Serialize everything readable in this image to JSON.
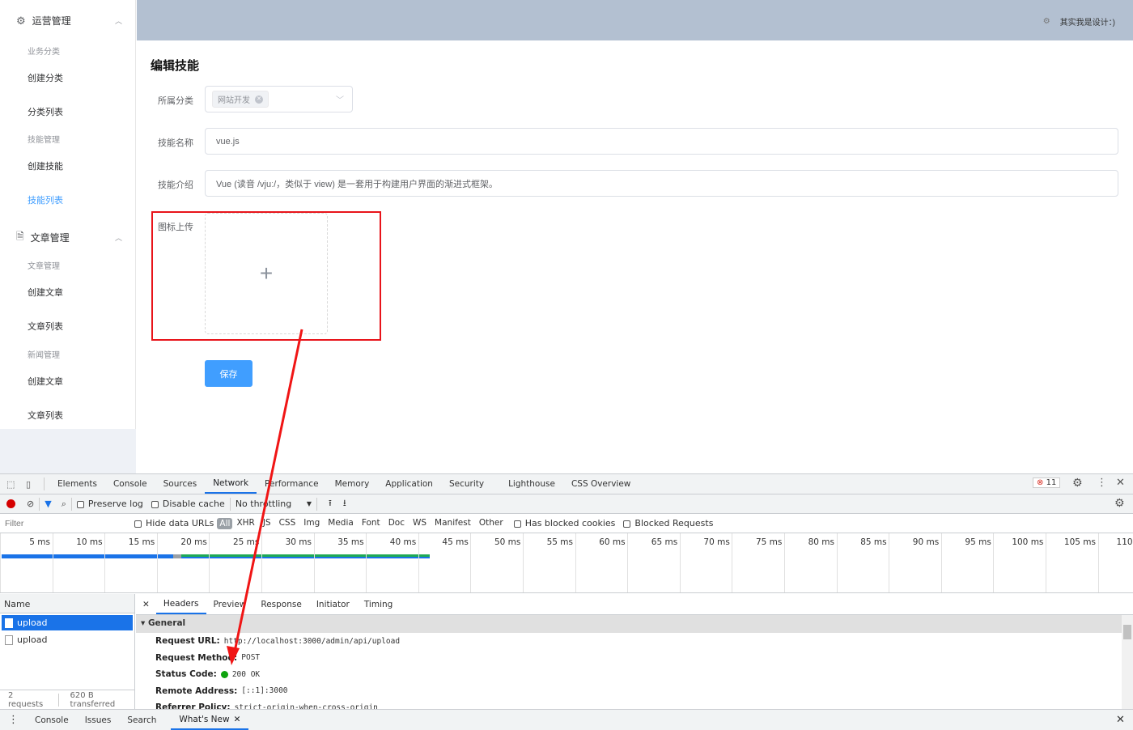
{
  "sidebar": {
    "groups": [
      {
        "label": "运营管理",
        "icon": "gear-icon",
        "sections": [
          {
            "title": "业务分类",
            "items": [
              "创建分类",
              "分类列表"
            ]
          },
          {
            "title": "技能管理",
            "items": [
              "创建技能",
              "技能列表"
            ]
          }
        ]
      },
      {
        "label": "文章管理",
        "icon": "document-icon",
        "sections": [
          {
            "title": "文章管理",
            "items": [
              "创建文章",
              "文章列表"
            ]
          },
          {
            "title": "新闻管理",
            "items": [
              "创建文章",
              "文章列表"
            ]
          }
        ]
      }
    ],
    "active_item": "技能列表"
  },
  "header": {
    "user_text": "其实我是设计：)"
  },
  "form": {
    "title": "编辑技能",
    "category_label": "所属分类",
    "category_tag": "网站开发",
    "name_label": "技能名称",
    "name_value": "vue.js",
    "intro_label": "技能介绍",
    "intro_value": "Vue (读音 /vjuː/，类似于 view) 是一套用于构建用户界面的渐进式框架。",
    "icon_label": "图标上传",
    "save_label": "保存"
  },
  "colors": {
    "accent": "#409eff",
    "header_bg": "#b3c0d1",
    "annotation": "#e8141a"
  },
  "devtools": {
    "tabs": [
      "Elements",
      "Console",
      "Sources",
      "Network",
      "Performance",
      "Memory",
      "Application",
      "Security",
      "Lighthouse",
      "CSS Overview"
    ],
    "active_tab": "Network",
    "error_count": "11",
    "preserve_log": "Preserve log",
    "disable_cache": "Disable cache",
    "throttling": "No throttling",
    "filter_placeholder": "Filter",
    "hide_data_urls": "Hide data URLs",
    "types": [
      "All",
      "XHR",
      "JS",
      "CSS",
      "Img",
      "Media",
      "Font",
      "Doc",
      "WS",
      "Manifest",
      "Other"
    ],
    "has_blocked": "Has blocked cookies",
    "blocked_requests": "Blocked Requests",
    "ticks": [
      "5 ms",
      "10 ms",
      "15 ms",
      "20 ms",
      "25 ms",
      "30 ms",
      "35 ms",
      "40 ms",
      "45 ms",
      "50 ms",
      "55 ms",
      "60 ms",
      "65 ms",
      "70 ms",
      "75 ms",
      "80 ms",
      "85 ms",
      "90 ms",
      "95 ms",
      "100 ms",
      "105 ms",
      "110 ms"
    ],
    "name_header": "Name",
    "requests": [
      "upload",
      "upload"
    ],
    "summary": {
      "count": "2 requests",
      "transferred": "620 B transferred"
    },
    "detail_tabs": [
      "Headers",
      "Preview",
      "Response",
      "Initiator",
      "Timing"
    ],
    "general_label": "General",
    "headers": [
      {
        "k": "Request URL:",
        "v": "http://localhost:3000/admin/api/upload"
      },
      {
        "k": "Request Method:",
        "v": "POST"
      },
      {
        "k": "Status Code:",
        "v": "200 OK"
      },
      {
        "k": "Remote Address:",
        "v": "[::1]:3000"
      },
      {
        "k": "Referrer Policy:",
        "v": "strict-origin-when-cross-origin"
      }
    ],
    "drawer_tabs": [
      "Console",
      "Issues",
      "Search",
      "What's New"
    ]
  }
}
